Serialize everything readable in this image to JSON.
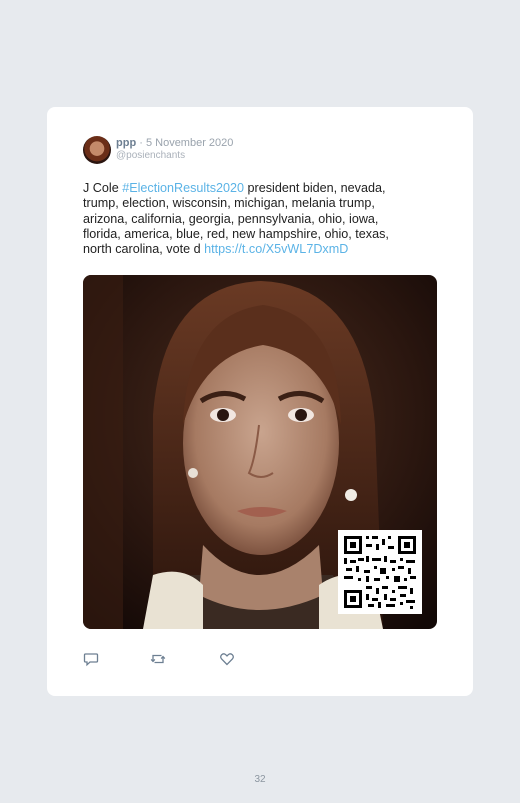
{
  "tweet": {
    "display_name": "ppp",
    "separator": " · ",
    "date": "5 November 2020",
    "handle": "@posienchants",
    "text_prefix": "J Cole ",
    "hashtag": "#ElectionResults2020",
    "text_body": " president biden, nevada, trump, election, wisconsin, michigan, melania trump, arizona, california, georgia, pennsylvania, ohio, iowa, florida, america, blue, red, new hampshire, ohio, texas, north carolina, vote d ",
    "link": "https://t.co/X5vWL7DxmD"
  },
  "icons": {
    "avatar": "profile-photo",
    "reply": "reply-icon",
    "retweet": "retweet-icon",
    "like": "heart-icon",
    "qr": "qr-code"
  },
  "colors": {
    "background": "#e7eaee",
    "card": "#ffffff",
    "link": "#5bb3e6"
  },
  "page": {
    "number": "32"
  }
}
